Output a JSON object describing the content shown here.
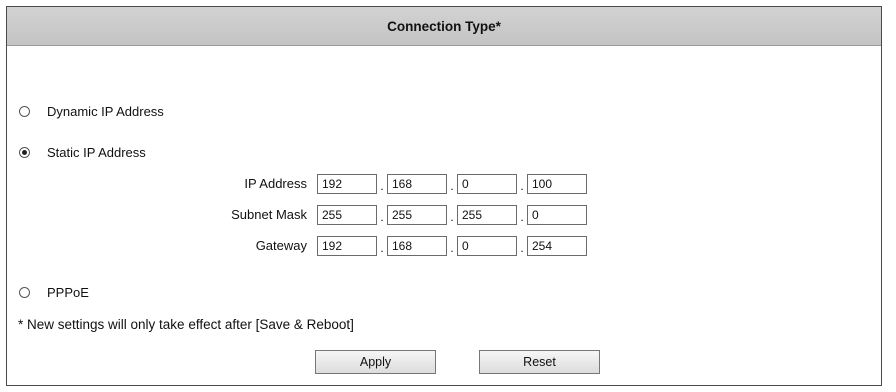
{
  "header": {
    "title": "Connection Type*"
  },
  "options": {
    "dynamic": {
      "label": "Dynamic IP Address",
      "selected": false
    },
    "static": {
      "label": "Static IP Address",
      "selected": true
    },
    "pppoe": {
      "label": "PPPoE",
      "selected": false
    }
  },
  "static_fields": {
    "ip_address": {
      "label": "IP Address",
      "octets": [
        "192",
        "168",
        "0",
        "100"
      ]
    },
    "subnet_mask": {
      "label": "Subnet Mask",
      "octets": [
        "255",
        "255",
        "255",
        "0"
      ]
    },
    "gateway": {
      "label": "Gateway",
      "octets": [
        "192",
        "168",
        "0",
        "254"
      ]
    }
  },
  "note": "* New settings will only take effect after [Save & Reboot]",
  "buttons": {
    "apply": "Apply",
    "reset": "Reset"
  }
}
